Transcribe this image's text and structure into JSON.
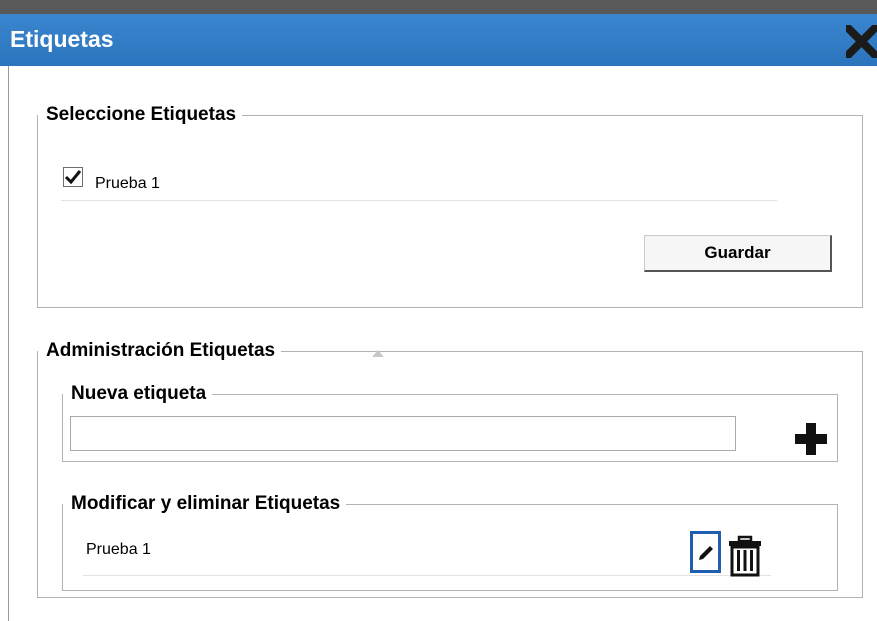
{
  "window": {
    "title": "Etiquetas",
    "close_icon": "close-x-icon",
    "title_color": "#2f7cc8"
  },
  "select_section": {
    "legend": "Seleccione Etiquetas",
    "items": [
      {
        "label": "Prueba 1",
        "checked": true
      }
    ],
    "save_label": "Guardar"
  },
  "admin_section": {
    "legend": "Administración Etiquetas",
    "collapse_icon": "triangle-up-icon",
    "new_tag": {
      "legend": "Nueva etiqueta",
      "input_value": "",
      "add_icon": "plus-icon"
    },
    "modify": {
      "legend": "Modificar y eliminar Etiquetas",
      "items": [
        {
          "label": "Prueba 1",
          "edit_icon": "pencil-icon",
          "delete_icon": "trash-icon"
        }
      ],
      "focus_color": "#1f5fae"
    }
  }
}
